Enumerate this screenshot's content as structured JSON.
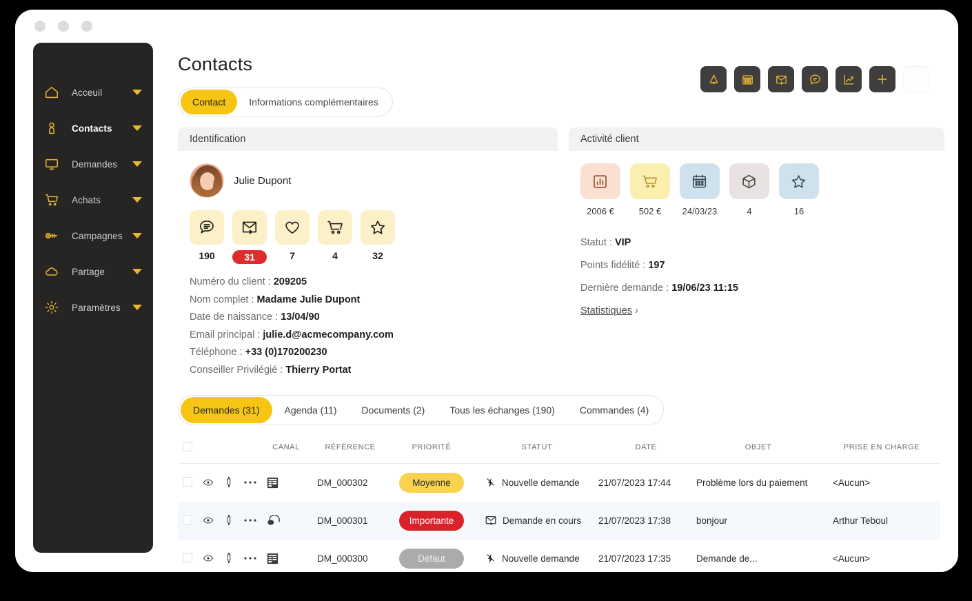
{
  "window": {
    "dots": [
      "minimize",
      "maximize",
      "close"
    ]
  },
  "sidebar": {
    "items": [
      {
        "label": "Acceuil",
        "icon": "home-icon",
        "active": false
      },
      {
        "label": "Contacts",
        "icon": "person-icon",
        "active": true
      },
      {
        "label": "Demandes",
        "icon": "monitor-icon",
        "active": false
      },
      {
        "label": "Achats",
        "icon": "cart-icon",
        "active": false
      },
      {
        "label": "Campagnes",
        "icon": "key-icon",
        "active": false
      },
      {
        "label": "Partage",
        "icon": "cloud-icon",
        "active": false
      },
      {
        "label": "Paramètres",
        "icon": "gear-icon",
        "active": false
      }
    ]
  },
  "header": {
    "title": "Contacts",
    "actions": [
      {
        "name": "bell-icon",
        "tooltip": "Notifications"
      },
      {
        "name": "calendar-icon",
        "tooltip": "Agenda"
      },
      {
        "name": "mail-icon",
        "tooltip": "Emails"
      },
      {
        "name": "chat-icon",
        "tooltip": "Messages"
      },
      {
        "name": "chart-icon",
        "tooltip": "Statistiques"
      },
      {
        "name": "plus-icon",
        "tooltip": "Ajouter"
      },
      {
        "name": "blank-icon",
        "tooltip": ""
      }
    ]
  },
  "segmented": {
    "items": [
      {
        "label": "Contact",
        "active": true
      },
      {
        "label": "Informations complémentaires",
        "active": false
      }
    ]
  },
  "identification": {
    "panel_title": "Identification",
    "contact_name": "Julie Dupont",
    "stats": [
      {
        "icon": "chat-bubble-icon",
        "value": "190",
        "highlight": false
      },
      {
        "icon": "mail-forward-icon",
        "value": "31",
        "highlight": true
      },
      {
        "icon": "heart-icon",
        "value": "7",
        "highlight": false
      },
      {
        "icon": "cart-icon",
        "value": "4",
        "highlight": false
      },
      {
        "icon": "star-icon",
        "value": "32",
        "highlight": false
      }
    ],
    "fields": [
      {
        "label": "Numéro du client :",
        "value": "209205"
      },
      {
        "label": "Nom complet :",
        "value": "Madame Julie Dupont"
      },
      {
        "label": "Date de naissance :",
        "value": "13/04/90"
      },
      {
        "label": "Email principal :",
        "value": "julie.d@acmecompany.com"
      },
      {
        "label": "Téléphone :",
        "value": "+33 (0)170200230"
      },
      {
        "label": "Conseiller Privilégié :",
        "value": "Thierry Portat"
      }
    ]
  },
  "activity": {
    "panel_title": "Activité client",
    "tiles": [
      {
        "icon": "bar-chart-icon",
        "caption": "2006 €",
        "bg": "#FBDFD0"
      },
      {
        "icon": "cart-icon",
        "caption": "502 €",
        "bg": "#FAEFAE"
      },
      {
        "icon": "calendar-icon",
        "caption": "24/03/23",
        "bg": "#CEE1EC"
      },
      {
        "icon": "box-icon",
        "caption": "4",
        "bg": "#E8E2E2"
      },
      {
        "icon": "star-icon",
        "caption": "16",
        "bg": "#CEE1EC"
      }
    ],
    "fields": [
      {
        "label": "Statut :",
        "value": "VIP"
      },
      {
        "label": "Points fidélité :",
        "value": "197"
      },
      {
        "label": "Dernière demande :",
        "value": "19/06/23  11:15"
      }
    ],
    "link": "Statistiques",
    "link_chevron": "›"
  },
  "tabs": [
    {
      "label": "Demandes (31)",
      "active": true
    },
    {
      "label": "Agenda (11)",
      "active": false
    },
    {
      "label": "Documents (2)",
      "active": false
    },
    {
      "label": "Tous les échanges (190)",
      "active": false
    },
    {
      "label": "Commandes (4)",
      "active": false
    }
  ],
  "table": {
    "columns": [
      "",
      "",
      "CANAL",
      "RÉFÉRENCE",
      "PRIORITÉ",
      "STATUT",
      "DATE",
      "OBJET",
      "PRISE EN CHARGE"
    ],
    "rows": [
      {
        "canal_icon": "form-icon",
        "reference": "DM_000302",
        "priority": "Moyenne",
        "priority_class": "moy",
        "status_icon": "new-request-icon",
        "status": "Nouvelle demande",
        "date": "21/07/2023 17:44",
        "objet": "Problème lors du paiement",
        "prise_en_charge": "<Aucun>",
        "alt": false
      },
      {
        "canal_icon": "headset-icon",
        "reference": "DM_000301",
        "priority": "Importante",
        "priority_class": "imp",
        "status_icon": "in-progress-icon",
        "status": "Demande en cours",
        "date": "21/07/2023 17:38",
        "objet": "bonjour",
        "prise_en_charge": "Arthur Teboul",
        "alt": true
      },
      {
        "canal_icon": "form-icon",
        "reference": "DM_000300",
        "priority": "Défaut",
        "priority_class": "def",
        "status_icon": "new-request-icon",
        "status": "Nouvelle demande",
        "date": "21/07/2023 17:35",
        "objet": "Demande de...",
        "prise_en_charge": "<Aucun>",
        "alt": false
      }
    ]
  },
  "colors": {
    "accent_yellow": "#F7C614",
    "sidebar_bg": "#262524",
    "icon_gold": "#E8B833",
    "danger_red": "#D8232A",
    "badge_red": "#DE2B2B",
    "tile_cream": "#FBF0C8",
    "alt_row": "#F5F9FD"
  }
}
